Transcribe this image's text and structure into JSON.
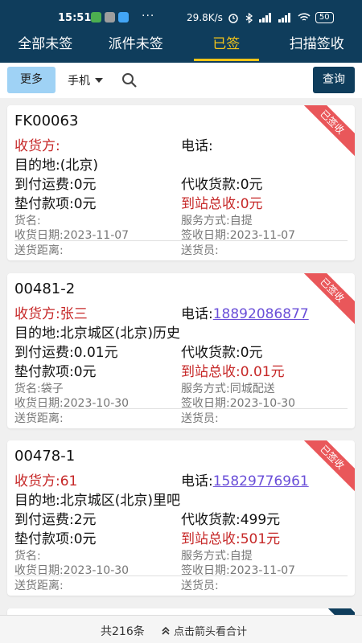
{
  "status_bar": {
    "time": "15:51",
    "dots": "···",
    "network_speed": "29.8K/s",
    "battery": "50"
  },
  "tabs": [
    {
      "label": "全部未签",
      "active": false
    },
    {
      "label": "派件未签",
      "active": false
    },
    {
      "label": "已签",
      "active": true
    },
    {
      "label": "扫描签收",
      "active": false
    }
  ],
  "search": {
    "more_label": "更多",
    "field_selected": "手机",
    "placeholder": "",
    "query_label": "查询"
  },
  "cards": [
    {
      "ribbon": "已签收",
      "order_no": "FK00063",
      "receiver_label": "收货方:",
      "receiver": "",
      "phone_label": "电话:",
      "phone": "",
      "destination_label": "目的地:",
      "destination": "(北京)",
      "freight_label": "到付运费:",
      "freight": "0元",
      "cod_label": "代收货款:",
      "cod": "0元",
      "advance_label": "垫付款项:",
      "advance": "0元",
      "station_total_label": "到站总收:",
      "station_total": "0元",
      "goods_label": "货名:",
      "goods": "",
      "service_label": "服务方式:",
      "service": "自提",
      "receive_date_label": "收货日期:",
      "receive_date": "2023-11-07",
      "sign_date_label": "签收日期:",
      "sign_date": "2023-11-07",
      "distance_label": "送货距离:",
      "distance": "",
      "courier_label": "送货员:",
      "courier": ""
    },
    {
      "ribbon": "已签收",
      "order_no": "00481-2",
      "receiver_label": "收货方:",
      "receiver": "张三",
      "phone_label": "电话:",
      "phone": "18892086877",
      "destination_label": "目的地:",
      "destination": "北京城区(北京)历史",
      "freight_label": "到付运费:",
      "freight": "0.01元",
      "cod_label": "代收货款:",
      "cod": "0元",
      "advance_label": "垫付款项:",
      "advance": "0元",
      "station_total_label": "到站总收:",
      "station_total": "0.01元",
      "goods_label": "货名:",
      "goods": "袋子",
      "service_label": "服务方式:",
      "service": "同城配送",
      "receive_date_label": "收货日期:",
      "receive_date": "2023-10-30",
      "sign_date_label": "签收日期:",
      "sign_date": "2023-10-30",
      "distance_label": "送货距离:",
      "distance": "",
      "courier_label": "送货员:",
      "courier": ""
    },
    {
      "ribbon": "已签收",
      "order_no": "00478-1",
      "receiver_label": "收货方:",
      "receiver": "61",
      "phone_label": "电话:",
      "phone": "15829776961",
      "destination_label": "目的地:",
      "destination": "北京城区(北京)里吧",
      "freight_label": "到付运费:",
      "freight": "2元",
      "cod_label": "代收货款:",
      "cod": "499元",
      "advance_label": "垫付款项:",
      "advance": "0元",
      "station_total_label": "到站总收:",
      "station_total": "501元",
      "goods_label": "货名:",
      "goods": "",
      "service_label": "服务方式:",
      "service": "自提",
      "receive_date_label": "收货日期:",
      "receive_date": "2023-10-30",
      "sign_date_label": "签收日期:",
      "sign_date": "2023-11-07",
      "distance_label": "送货距离:",
      "distance": "",
      "courier_label": "送货员:",
      "courier": ""
    }
  ],
  "footer": {
    "count_text": "共216条",
    "hint_text": "点击箭头看合计"
  },
  "colors": {
    "header": "#0f3d5c",
    "active_tab": "#f5c518",
    "ribbon": "#e9575a",
    "accent_red": "#c62828",
    "link": "#6a4fd8"
  }
}
